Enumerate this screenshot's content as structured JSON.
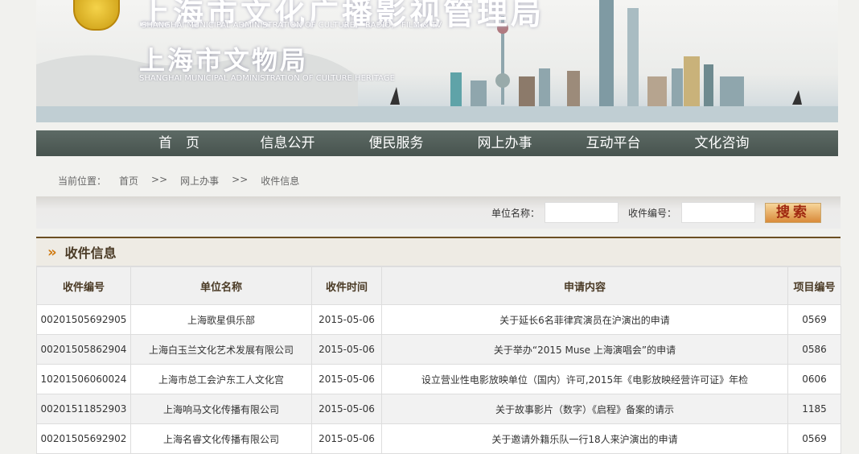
{
  "banner": {
    "title1": "上海市文化广播影视管理局",
    "subtitle1": "SHANGHAI MUNICIPAL ADMINISTRATION OF CULTURE， RADIO， FILM & TV",
    "title2": "上海市文物局",
    "subtitle2": "SHANGHAI MUNICIPAL ADMINISTRATION OF CULTURE HERITAGE"
  },
  "nav": [
    "首　页",
    "信息公开",
    "便民服务",
    "网上办事",
    "互动平台",
    "文化咨询"
  ],
  "breadcrumb": {
    "label": "当前位置：",
    "items": [
      "首页",
      ">>",
      "网上办事",
      ">>",
      "收件信息"
    ]
  },
  "search": {
    "unit_label": "单位名称：",
    "unit_value": "",
    "id_label": "收件编号：",
    "id_value": "",
    "button": "搜索"
  },
  "panel": {
    "title": "收件信息"
  },
  "table": {
    "headers": [
      "收件编号",
      "单位名称",
      "收件时间",
      "申请内容",
      "项目编号"
    ],
    "rows": [
      [
        "00201505692905",
        "上海歌星俱乐部",
        "2015-05-06",
        "关于延长6名菲律宾演员在沪演出的申请",
        "0569"
      ],
      [
        "00201505862904",
        "上海白玉兰文化艺术发展有限公司",
        "2015-05-06",
        "关于举办“2015 Muse 上海演唱会”的申请",
        "0586"
      ],
      [
        "10201506060024",
        "上海市总工会沪东工人文化宫",
        "2015-05-06",
        "设立营业性电影放映单位（国内）许可,2015年《电影放映经营许可证》年检",
        "0606"
      ],
      [
        "00201511852903",
        "上海响马文化传播有限公司",
        "2015-05-06",
        "关于故事影片（数字）《启程》备案的请示",
        "1185"
      ],
      [
        "00201505692902",
        "上海名睿文化传播有限公司",
        "2015-05-06",
        "关于邀请外籍乐队一行18人来沪演出的申请",
        "0569"
      ]
    ]
  }
}
